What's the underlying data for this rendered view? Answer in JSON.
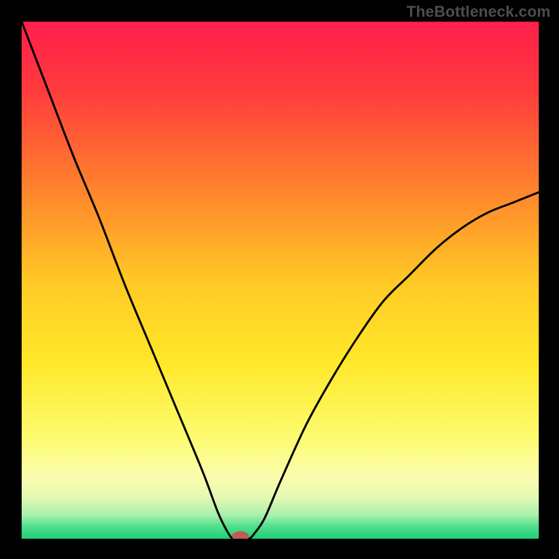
{
  "attribution": "TheBottleneck.com",
  "chart_data": {
    "type": "line",
    "title": "",
    "xlabel": "",
    "ylabel": "",
    "xlim": [
      0,
      100
    ],
    "ylim": [
      0,
      100
    ],
    "grid": false,
    "series": [
      {
        "name": "bottleneck-curve",
        "x": [
          0,
          5,
          10,
          15,
          20,
          25,
          30,
          35,
          38,
          40,
          41,
          42,
          43,
          44,
          45,
          47,
          50,
          55,
          60,
          65,
          70,
          75,
          80,
          85,
          90,
          95,
          100
        ],
        "y": [
          100,
          87,
          74,
          62,
          49,
          37,
          25,
          13,
          5,
          1,
          0,
          0,
          0,
          0,
          1,
          4,
          11,
          22,
          31,
          39,
          46,
          51,
          56,
          60,
          63,
          65,
          67
        ]
      }
    ],
    "gradient_stops": [
      {
        "offset": 0.0,
        "color": "#ff1f4c"
      },
      {
        "offset": 0.13,
        "color": "#ff3a3d"
      },
      {
        "offset": 0.3,
        "color": "#ff7a2e"
      },
      {
        "offset": 0.5,
        "color": "#ffc825"
      },
      {
        "offset": 0.66,
        "color": "#ffe82a"
      },
      {
        "offset": 0.8,
        "color": "#fdfb6e"
      },
      {
        "offset": 0.88,
        "color": "#fbfdae"
      },
      {
        "offset": 0.92,
        "color": "#e3f9b2"
      },
      {
        "offset": 0.955,
        "color": "#a8efad"
      },
      {
        "offset": 0.975,
        "color": "#54e08e"
      },
      {
        "offset": 1.0,
        "color": "#1fce77"
      }
    ],
    "marker": {
      "x": 42.3,
      "y": 0.5,
      "color": "#c05a52",
      "rx": 12,
      "ry": 7
    }
  }
}
